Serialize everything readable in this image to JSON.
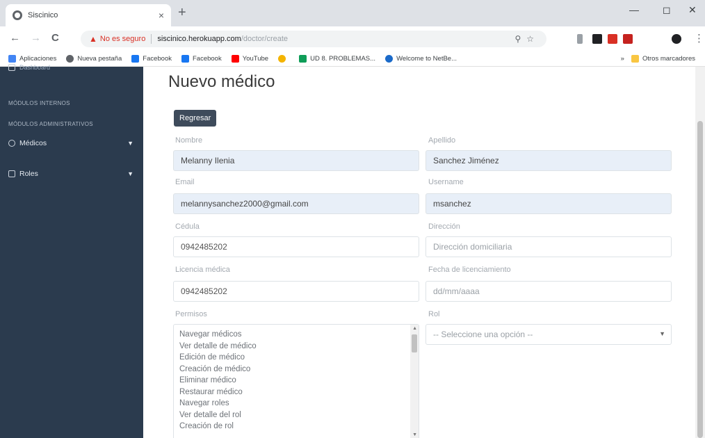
{
  "browser": {
    "tab_title": "Siscinico",
    "tab_close": "×",
    "new_tab": "+",
    "window_controls": {
      "minimize": "—",
      "maximize": "◻",
      "close": "✕"
    },
    "nav": {
      "back": "←",
      "forward": "→",
      "reload": "C"
    },
    "omnibox": {
      "security_warning": "No es seguro",
      "host": "siscinico.herokuapp.com",
      "path": "/doctor/create"
    }
  },
  "bookmarks": [
    {
      "label": "Aplicaciones",
      "icon": "apps-icon",
      "color": "#4285f4"
    },
    {
      "label": "Nueva pestaña",
      "icon": "globe-icon",
      "color": "#5f6368"
    },
    {
      "label": "Facebook",
      "icon": "facebook-icon",
      "color": "#1877f2"
    },
    {
      "label": "Facebook",
      "icon": "facebook-icon",
      "color": "#1877f2"
    },
    {
      "label": "YouTube",
      "icon": "youtube-icon",
      "color": "#ff0000"
    },
    {
      "label": "",
      "icon": "g-icon",
      "color": "#f4b400"
    },
    {
      "label": "UD 8. PROBLEMAS...",
      "icon": "doc-icon",
      "color": "#0f9d58"
    },
    {
      "label": "Welcome to NetBe...",
      "icon": "netbeans-icon",
      "color": "#1b6ac9"
    }
  ],
  "bookmarks_more": "»",
  "bookmarks_other": "Otros marcadores",
  "sidebar": {
    "dashboard": "Dashboard",
    "section1": "Módulos internos",
    "section2": "Módulos administrativos",
    "items": [
      {
        "label": "Médicos"
      },
      {
        "label": "Roles"
      }
    ]
  },
  "main": {
    "title": "Nuevo médico",
    "back_button": "Regresar",
    "fields": {
      "nombre_label": "Nombre",
      "nombre_value": "Melanny Ilenia",
      "apellido_label": "Apellido",
      "apellido_value": "Sanchez Jiménez",
      "email_label": "Email",
      "email_value": "melannysanchez2000@gmail.com",
      "username_label": "Username",
      "username_value": "msanchez",
      "cedula_label": "Cédula",
      "cedula_value": "0942485202",
      "direccion_label": "Dirección",
      "direccion_placeholder": "Dirección domiciliaria",
      "licencia_label": "Licencia médica",
      "licencia_value": "0942485202",
      "fecha_label": "Fecha de licenciamiento",
      "fecha_placeholder": "dd/mm/aaaa",
      "permisos_label": "Permisos",
      "rol_label": "Rol",
      "rol_selected": "-- Seleccione una opción --"
    },
    "permisos": [
      "Navegar médicos",
      "Ver detalle de médico",
      "Edición de médico",
      "Creación de médico",
      "Eliminar médico",
      "Restaurar médico",
      "Navegar roles",
      "Ver detalle del rol",
      "Creación de rol"
    ]
  },
  "colors": {
    "sidebar_bg": "#2b3b4e",
    "button_bg": "#3e4b5b",
    "filled_field_bg": "#e8eff8"
  }
}
